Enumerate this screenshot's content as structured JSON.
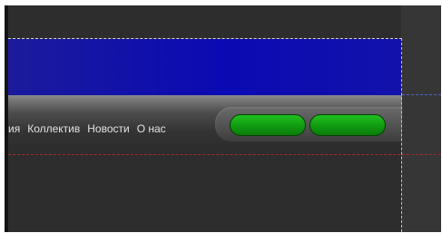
{
  "nav": {
    "links": [
      {
        "label": "ия"
      },
      {
        "label": "Коллектив"
      },
      {
        "label": "Новости"
      },
      {
        "label": "О нас"
      }
    ]
  },
  "colors": {
    "banner": "#0a0ab4",
    "button": "#119a11",
    "background": "#2d2d2d"
  }
}
